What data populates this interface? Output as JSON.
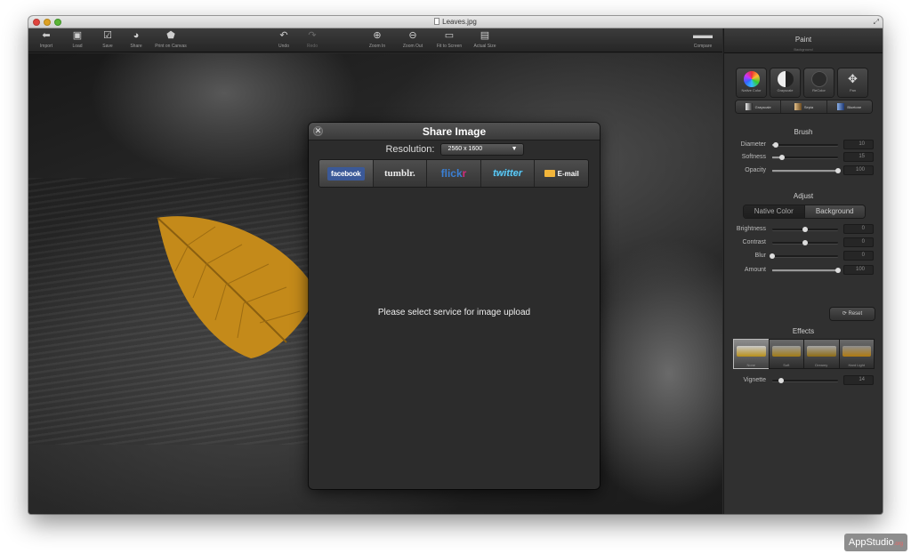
{
  "window": {
    "title": "Leaves.jpg"
  },
  "toolbar": {
    "import": "Import",
    "load": "Load",
    "save": "Save",
    "share": "Share",
    "print": "Print on Canvas",
    "undo": "Undo",
    "redo": "Redo",
    "zoom_in": "Zoom In",
    "zoom_out": "Zoom Out",
    "fit": "Fit to Screen",
    "actual": "Actual Size",
    "compare": "Compare"
  },
  "dialog": {
    "title": "Share Image",
    "resolution_label": "Resolution:",
    "resolution_value": "2560 x 1600",
    "services": {
      "facebook": "facebook",
      "tumblr": "tumblr.",
      "flickr_a": "flick",
      "flickr_b": "r",
      "twitter": "twitter",
      "email": "E-mail"
    },
    "message": "Please select service for image upload"
  },
  "panel": {
    "paint_title": "Paint",
    "paint_sub": "Background",
    "tools": [
      "Native Color",
      "Grayscale",
      "ReColor",
      "Pan"
    ],
    "modes": [
      "Grayscale",
      "Sepia",
      "Bluetone"
    ],
    "brush_title": "Brush",
    "brush": [
      {
        "label": "Diameter",
        "value": "10",
        "fraction": 0.05
      },
      {
        "label": "Softness",
        "value": "15",
        "fraction": 0.15
      },
      {
        "label": "Opacity",
        "value": "100",
        "fraction": 1.0
      }
    ],
    "adjust_title": "Adjust",
    "adjust_tabs": [
      "Native Color",
      "Background"
    ],
    "adjust": [
      {
        "label": "Brightness",
        "value": "0",
        "fraction": 0.5
      },
      {
        "label": "Contrast",
        "value": "0",
        "fraction": 0.5
      },
      {
        "label": "Blur",
        "value": "0",
        "fraction": 0.0
      },
      {
        "label": "Amount",
        "value": "100",
        "fraction": 1.0
      }
    ],
    "reset": "Reset",
    "effects_title": "Effects",
    "effects": [
      "None",
      "Soft",
      "Dreamy",
      "Hard Light"
    ],
    "vignette": {
      "label": "Vignette",
      "value": "14",
      "fraction": 0.14
    }
  },
  "watermark": {
    "main": "AppStudio",
    "suffix": ".org"
  },
  "colors": {
    "leaf": "#c48a1a",
    "facebook": "#3b5998",
    "twitter": "#5ec7f0",
    "flickr_pink": "#d22c7c"
  }
}
